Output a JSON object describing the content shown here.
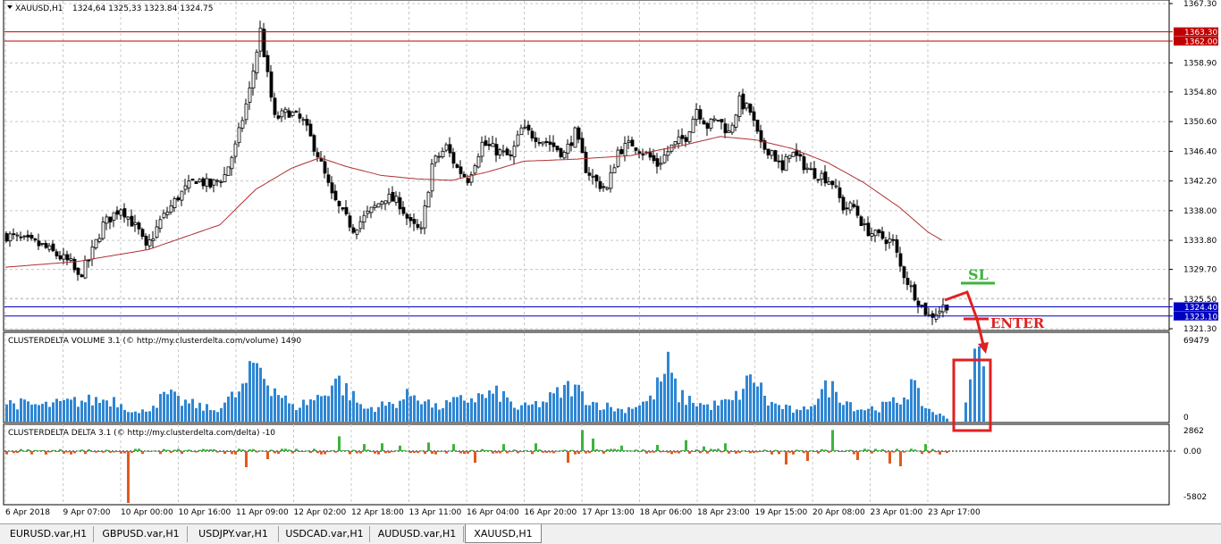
{
  "header": {
    "symbol": "XAUUSD,H1",
    "ohlc": "1324,64 1325,33 1323.84 1324.75"
  },
  "price_axis": {
    "ticks": [
      "1367.30",
      "1358.90",
      "1354.80",
      "1350.60",
      "1346.40",
      "1342.20",
      "1338.00",
      "1333.80",
      "1329.70",
      "1325.50",
      "1321.30"
    ],
    "tick_values": [
      1367.3,
      1358.9,
      1354.8,
      1350.6,
      1346.4,
      1342.2,
      1338.0,
      1333.8,
      1329.7,
      1325.5,
      1321.3
    ],
    "ylim": [
      1321.3,
      1367.3
    ]
  },
  "levels": [
    {
      "label": "1363.30",
      "value": 1363.3,
      "color": "#c00000"
    },
    {
      "label": "1362.00",
      "value": 1362.0,
      "color": "#c00000"
    },
    {
      "label": "1324.40",
      "value": 1324.4,
      "color": "#0000c0"
    },
    {
      "label": "1323.10",
      "value": 1323.1,
      "color": "#0000c0"
    }
  ],
  "annotations": {
    "sl": "SL",
    "enter": "ENTER",
    "sl_color": "#3cb43c",
    "enter_color": "#e02020"
  },
  "volume_panel": {
    "title": "CLUSTERDELTA VOLUME 3.1 (© http://my.clusterdelta.com/volume) 1490",
    "max_label": "69479",
    "min_label": "0",
    "max_value": 69479,
    "color": "#2e86d4"
  },
  "delta_panel": {
    "title": "CLUSTERDELTA DELTA 3.1 (© http://my.clusterdelta.com/delta) -10",
    "top_label": "2862",
    "zero_label": "0.00",
    "bottom_label": "-5802",
    "top_value": 2862,
    "bottom_value": -5802,
    "pos_color": "#3cb43c",
    "neg_color": "#e05a1e"
  },
  "time_axis": {
    "labels": [
      "6 Apr 2018",
      "9 Apr 07:00",
      "10 Apr 00:00",
      "10 Apr 16:00",
      "11 Apr 09:00",
      "12 Apr 02:00",
      "12 Apr 18:00",
      "13 Apr 11:00",
      "16 Apr 04:00",
      "16 Apr 20:00",
      "17 Apr 13:00",
      "18 Apr 06:00",
      "18 Apr 23:00",
      "19 Apr 15:00",
      "20 Apr 08:00",
      "23 Apr 01:00",
      "23 Apr 17:00"
    ]
  },
  "tabs": [
    {
      "label": "EURUSD.var,H1",
      "active": false
    },
    {
      "label": "GBPUSD.var,H1",
      "active": false
    },
    {
      "label": "USDJPY.var,H1",
      "active": false
    },
    {
      "label": "USDCAD.var,H1",
      "active": false
    },
    {
      "label": "AUDUSD.var,H1",
      "active": false
    },
    {
      "label": "XAUUSD,H1",
      "active": true
    }
  ],
  "chart_data": {
    "type": "candlestick",
    "title": "XAUUSD,H1",
    "ylim": [
      1321.3,
      1367.3
    ],
    "close_anchors": [
      [
        0,
        1334.5
      ],
      [
        10,
        1333.0
      ],
      [
        18,
        1330.5
      ],
      [
        20,
        1328.5
      ],
      [
        23,
        1331.0
      ],
      [
        27,
        1336.0
      ],
      [
        32,
        1338.5
      ],
      [
        37,
        1335.0
      ],
      [
        39,
        1332.5
      ],
      [
        43,
        1336.5
      ],
      [
        48,
        1340.0
      ],
      [
        53,
        1342.5
      ],
      [
        57,
        1341.5
      ],
      [
        61,
        1343.0
      ],
      [
        64,
        1347.0
      ],
      [
        68,
        1355.0
      ],
      [
        71,
        1363.5
      ],
      [
        73,
        1357.0
      ],
      [
        75,
        1351.0
      ],
      [
        79,
        1352.0
      ],
      [
        83,
        1350.5
      ],
      [
        87,
        1346.0
      ],
      [
        91,
        1340.0
      ],
      [
        94,
        1337.5
      ],
      [
        97,
        1335.5
      ],
      [
        102,
        1338.0
      ],
      [
        106,
        1340.0
      ],
      [
        110,
        1339.0
      ],
      [
        113,
        1336.0
      ],
      [
        116,
        1335.0
      ],
      [
        119,
        1344.5
      ],
      [
        123,
        1347.0
      ],
      [
        126,
        1344.0
      ],
      [
        129,
        1342.5
      ],
      [
        133,
        1347.5
      ],
      [
        137,
        1346.5
      ],
      [
        141,
        1345.5
      ],
      [
        144,
        1349.5
      ],
      [
        148,
        1348.5
      ],
      [
        152,
        1347.5
      ],
      [
        156,
        1346.0
      ],
      [
        159,
        1349.0
      ],
      [
        162,
        1344.0
      ],
      [
        165,
        1342.0
      ],
      [
        168,
        1341.0
      ],
      [
        171,
        1346.5
      ],
      [
        175,
        1347.5
      ],
      [
        179,
        1346.0
      ],
      [
        182,
        1344.5
      ],
      [
        186,
        1347.0
      ],
      [
        190,
        1348.5
      ],
      [
        193,
        1352.5
      ],
      [
        196,
        1350.0
      ],
      [
        199,
        1351.0
      ],
      [
        202,
        1349.0
      ],
      [
        205,
        1353.5
      ],
      [
        208,
        1352.0
      ],
      [
        211,
        1347.0
      ],
      [
        214,
        1346.5
      ],
      [
        217,
        1343.5
      ],
      [
        219,
        1346.5
      ],
      [
        222,
        1345.0
      ],
      [
        225,
        1343.5
      ],
      [
        228,
        1343.0
      ],
      [
        231,
        1342.0
      ],
      [
        234,
        1338.5
      ],
      [
        237,
        1338.5
      ],
      [
        240,
        1335.5
      ],
      [
        243,
        1334.5
      ],
      [
        246,
        1334.0
      ],
      [
        248,
        1333.5
      ],
      [
        250,
        1330.0
      ],
      [
        253,
        1327.0
      ],
      [
        256,
        1324.5
      ],
      [
        258,
        1323.0
      ],
      [
        261,
        1324.0
      ],
      [
        263,
        1324.75
      ]
    ],
    "sma_anchors": [
      [
        0,
        1330.0
      ],
      [
        20,
        1330.8
      ],
      [
        40,
        1332.5
      ],
      [
        60,
        1336.0
      ],
      [
        70,
        1341.0
      ],
      [
        80,
        1344.0
      ],
      [
        88,
        1345.5
      ],
      [
        95,
        1344.3
      ],
      [
        105,
        1343.0
      ],
      [
        115,
        1342.5
      ],
      [
        125,
        1342.3
      ],
      [
        135,
        1343.5
      ],
      [
        145,
        1345.0
      ],
      [
        160,
        1345.3
      ],
      [
        175,
        1345.8
      ],
      [
        190,
        1347.3
      ],
      [
        200,
        1348.5
      ],
      [
        210,
        1348.0
      ],
      [
        220,
        1346.8
      ],
      [
        230,
        1344.8
      ],
      [
        240,
        1342.0
      ],
      [
        250,
        1338.5
      ],
      [
        258,
        1335.0
      ],
      [
        262,
        1333.8
      ]
    ],
    "volume_peaks": [
      [
        0,
        0.3
      ],
      [
        10,
        0.25
      ],
      [
        20,
        0.32
      ],
      [
        30,
        0.35
      ],
      [
        37,
        0.12
      ],
      [
        45,
        0.42
      ],
      [
        48,
        0.33
      ],
      [
        58,
        0.18
      ],
      [
        66,
        0.5
      ],
      [
        70,
        0.95
      ],
      [
        73,
        0.65
      ],
      [
        80,
        0.22
      ],
      [
        88,
        0.4
      ],
      [
        92,
        0.68
      ],
      [
        100,
        0.2
      ],
      [
        108,
        0.28
      ],
      [
        114,
        0.45
      ],
      [
        120,
        0.22
      ],
      [
        128,
        0.35
      ],
      [
        138,
        0.44
      ],
      [
        143,
        0.2
      ],
      [
        150,
        0.3
      ],
      [
        158,
        0.56
      ],
      [
        164,
        0.3
      ],
      [
        172,
        0.18
      ],
      [
        180,
        0.34
      ],
      [
        185,
        0.86
      ],
      [
        188,
        0.4
      ],
      [
        196,
        0.24
      ],
      [
        203,
        0.32
      ],
      [
        209,
        0.72
      ],
      [
        213,
        0.3
      ],
      [
        222,
        0.14
      ],
      [
        230,
        0.56
      ],
      [
        238,
        0.2
      ],
      [
        244,
        0.22
      ],
      [
        250,
        0.34
      ],
      [
        253,
        0.58
      ],
      [
        257,
        0.22
      ],
      [
        263,
        0.05
      ]
    ],
    "delta_spikes": [
      [
        34,
        -5802
      ],
      [
        67,
        -1800
      ],
      [
        73,
        -900
      ],
      [
        93,
        1900
      ],
      [
        100,
        900
      ],
      [
        105,
        1000
      ],
      [
        110,
        700
      ],
      [
        118,
        1100
      ],
      [
        125,
        900
      ],
      [
        131,
        -1300
      ],
      [
        139,
        900
      ],
      [
        148,
        1000
      ],
      [
        157,
        -1300
      ],
      [
        161,
        2700
      ],
      [
        164,
        1600
      ],
      [
        172,
        700
      ],
      [
        182,
        800
      ],
      [
        190,
        1400
      ],
      [
        195,
        600
      ],
      [
        201,
        1000
      ],
      [
        218,
        -1500
      ],
      [
        224,
        -1100
      ],
      [
        231,
        2700
      ],
      [
        238,
        -1000
      ],
      [
        247,
        -1400
      ],
      [
        250,
        -1700
      ],
      [
        257,
        900
      ]
    ],
    "total_bars": 264
  }
}
